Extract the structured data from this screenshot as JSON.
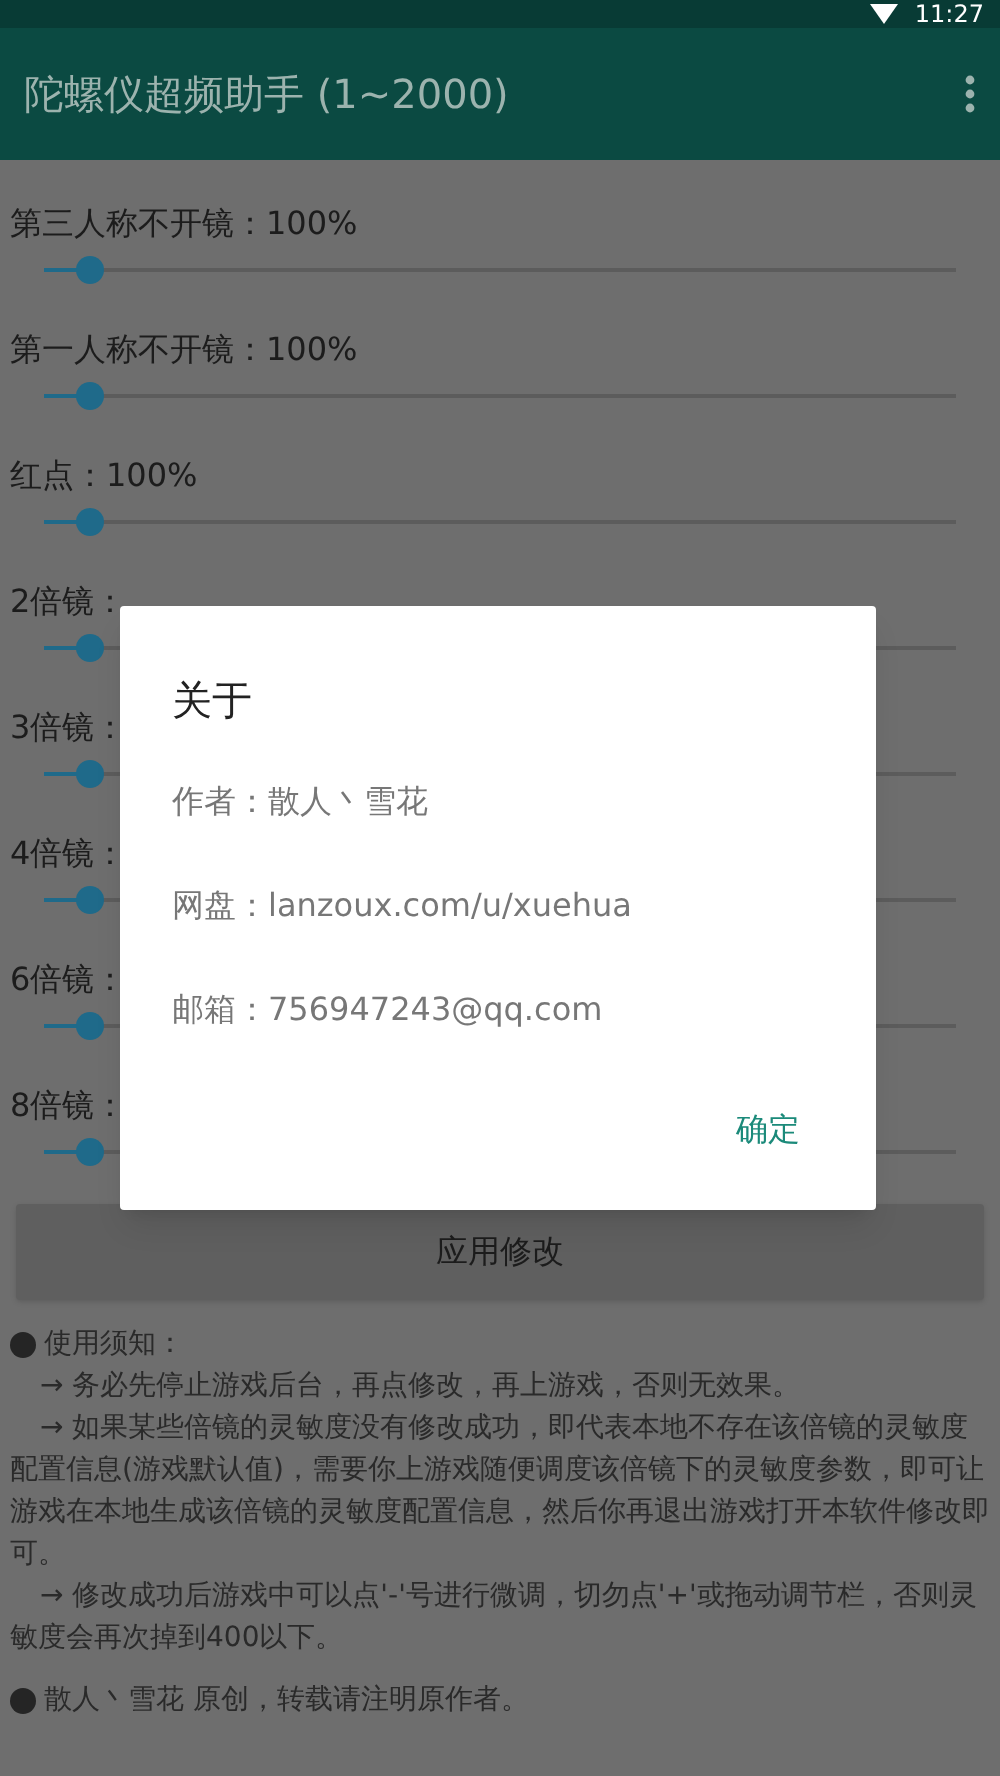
{
  "status_bar": {
    "time": "11:27"
  },
  "app_bar": {
    "title": "陀螺仪超频助手 (1~2000)"
  },
  "sliders": [
    {
      "label": "第三人称不开镜：100%",
      "level": 0.05
    },
    {
      "label": "第一人称不开镜：100%",
      "level": 0.05
    },
    {
      "label": "红点：100%",
      "level": 0.05
    },
    {
      "label": "2倍镜：",
      "level": 0.05
    },
    {
      "label": "3倍镜：",
      "level": 0.05
    },
    {
      "label": "4倍镜：",
      "level": 0.05
    },
    {
      "label": "6倍镜：",
      "level": 0.05
    },
    {
      "label": "8倍镜：",
      "level": 0.05
    }
  ],
  "apply_button": "应用修改",
  "notes": [
    {
      "kind": "bullet",
      "text": "使用须知："
    },
    {
      "kind": "arrow",
      "text": "→ 务必先停止游戏后台，再点修改，再上游戏，否则无效果。"
    },
    {
      "kind": "arrow",
      "text": "→ 如果某些倍镜的灵敏度没有修改成功，即代表本地不存在该倍镜的灵敏度配置信息(游戏默认值)，需要你上游戏随便调度该倍镜下的灵敏度参数，即可让游戏在本地生成该倍镜的灵敏度配置信息，然后你再退出游戏打开本软件修改即可。"
    },
    {
      "kind": "arrow",
      "text": "→ 修改成功后游戏中可以点'-'号进行微调，切勿点'+'或拖动调节栏，否则灵敏度会再次掉到400以下。"
    },
    {
      "kind": "bullet",
      "text": "散人丶雪花 原创，转载请注明原作者。"
    }
  ],
  "dialog": {
    "title": "关于",
    "lines": [
      "作者：散人丶雪花",
      "网盘：lanzoux.com/u/xuehua",
      "邮箱：756947243@qq.com"
    ],
    "button": "确定"
  }
}
